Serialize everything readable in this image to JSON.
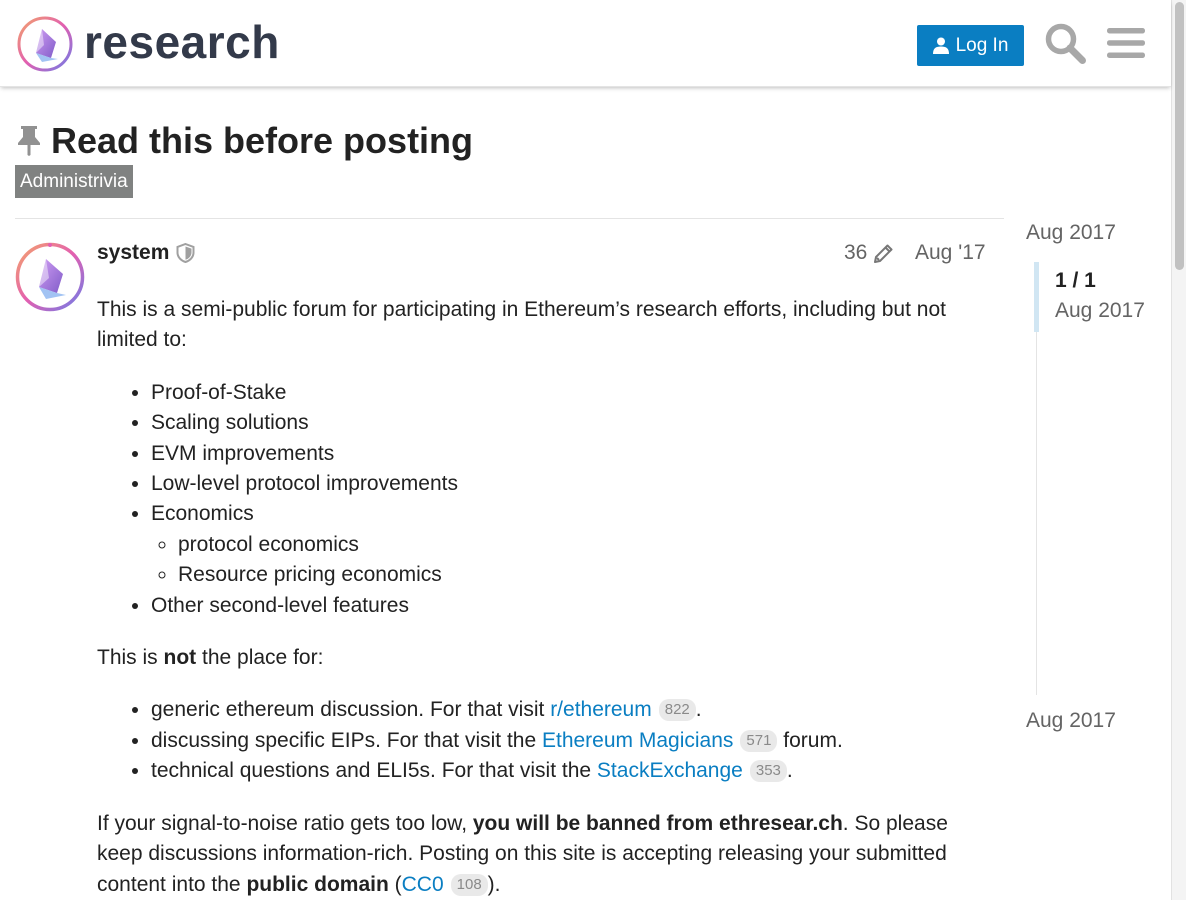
{
  "header": {
    "brand": "research",
    "login_label": "Log In"
  },
  "topic": {
    "title": "Read this before posting",
    "category": "Administrivia"
  },
  "post": {
    "username": "system",
    "edit_count": "36",
    "date": "Aug '17",
    "intro": "This is a semi-public forum for participating in Ethereum’s research efforts, including but not limited to:",
    "topics": [
      "Proof-of-Stake",
      "Scaling solutions",
      "EVM improvements",
      "Low-level protocol improvements",
      "Economics",
      "Other second-level features"
    ],
    "economics_subtopics": [
      "protocol economics",
      "Resource pricing economics"
    ],
    "not_place": {
      "prefix": "This is ",
      "emphasis": "not",
      "suffix": " the place for:"
    },
    "redirects": [
      {
        "text": "generic ethereum discussion. For that visit ",
        "link": "r/ethereum",
        "count": "822",
        "after": "."
      },
      {
        "text": "discussing specific EIPs. For that visit the ",
        "link": "Ethereum Magicians",
        "count": "571",
        "after": " forum."
      },
      {
        "text": "technical questions and ELI5s. For that visit the ",
        "link": "StackExchange",
        "count": "353",
        "after": "."
      }
    ],
    "policy": {
      "t1": "If your signal-to-noise ratio gets too low, ",
      "b1": "you will be banned from ethresear.ch",
      "t2": ". So please keep discussions information-rich. Posting on this site is accepting releasing your submitted content into the ",
      "b2": "public domain",
      "t3": " (",
      "link": "CC0",
      "count": "108",
      "t4": ")."
    }
  },
  "timeline": {
    "start": "Aug 2017",
    "position": "1 / 1",
    "position_date": "Aug 2017",
    "end": "Aug 2017",
    "progress": 1
  },
  "colors": {
    "accent": "#0a7ec2",
    "category": "#808281",
    "text": "#222222",
    "muted": "#646464"
  },
  "icons": [
    "logo-icon",
    "user-icon",
    "search-icon",
    "hamburger-menu-icon",
    "pin-icon",
    "shield-icon",
    "pencil-icon"
  ]
}
